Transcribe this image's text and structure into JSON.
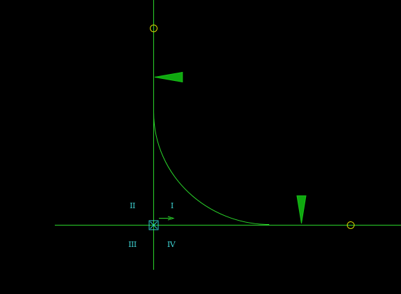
{
  "view": {
    "background": "#000000"
  },
  "colors": {
    "axis": "#2bd62b",
    "curve": "#2bd62b",
    "marker_fill": "#0fa80f",
    "marker_stroke": "#18c018",
    "handle": "#d8d800",
    "quadrant_label": "#3fd6d6",
    "origin_box": "#30d0d0",
    "direction_arrow": "#2bd62b"
  },
  "quadrants": {
    "q1": "I",
    "q2": "II",
    "q3": "III",
    "q4": "IV"
  },
  "icons": {
    "origin": "origin-box-cross-icon",
    "direction": "x-direction-arrow-icon",
    "vertical_marker": "triangle-left-marker-icon",
    "horizontal_marker": "triangle-down-marker-icon",
    "top_handle": "circle-handle-icon",
    "right_handle": "circle-handle-icon"
  }
}
